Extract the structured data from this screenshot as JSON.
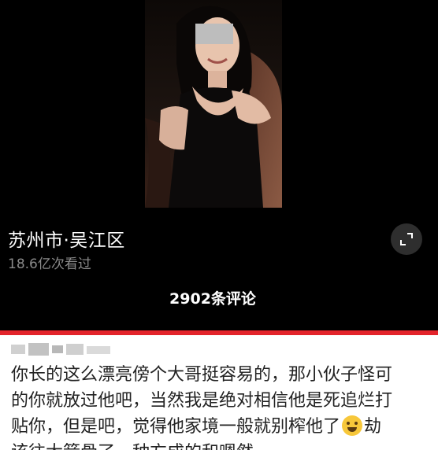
{
  "video": {
    "thumbnail_icon": "person-in-car-photo"
  },
  "info": {
    "location": "苏州市·吴江区",
    "views": "18.6亿次看过",
    "expand_icon": "fullscreen-icon"
  },
  "comments": {
    "count_label": "2902条评论",
    "first": {
      "lines": [
        "你长的这么漂亮傍个大哥挺容易的，那小伙子怪可",
        "的你就放过他吧，当然我是绝对相信他是死追烂打",
        "贴你，但是吧，觉得他家境一般就别榨他了",
        "劫",
        "该往大箭骨了，种方成的和嗯然"
      ],
      "emoji_icon": "crying-laughing-emoji-icon"
    }
  },
  "colors": {
    "divider": "#e3242b",
    "background": "#000000",
    "comment_bg": "#ffffff"
  }
}
